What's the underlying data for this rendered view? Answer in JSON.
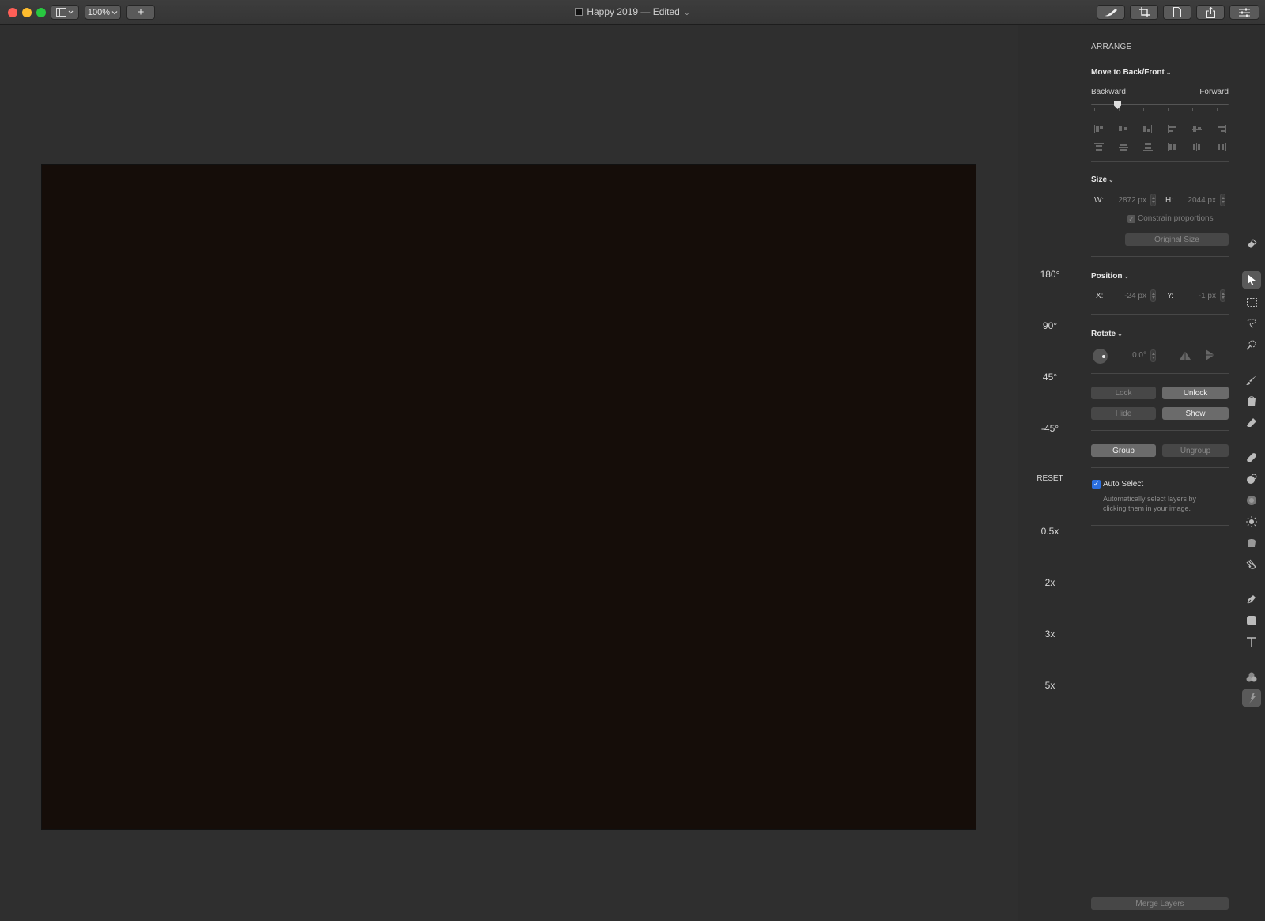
{
  "window": {
    "title": "Happy 2019 — Edited",
    "title_chevron": "⌄",
    "zoom_value": "100%",
    "add_label": "+"
  },
  "quick_actions": [
    "180°",
    "90°",
    "45°",
    "-45°",
    "RESET",
    "0.5x",
    "2x",
    "3x",
    "5x"
  ],
  "inspector": {
    "section_title": "ARRANGE",
    "move_label": "Move to Back/Front",
    "backward_label": "Backward",
    "forward_label": "Forward",
    "size_label": "Size",
    "w_label": "W:",
    "w_value": "2872 px",
    "h_label": "H:",
    "h_value": "2044 px",
    "constrain_label": "Constrain proportions",
    "original_size_label": "Original Size",
    "position_label": "Position",
    "x_label": "X:",
    "x_value": "-24 px",
    "y_label": "Y:",
    "y_value": "-1 px",
    "rotate_label": "Rotate",
    "rotate_value": "0.0°",
    "lock_label": "Lock",
    "unlock_label": "Unlock",
    "hide_label": "Hide",
    "show_label": "Show",
    "group_label": "Group",
    "ungroup_label": "Ungroup",
    "auto_select_label": "Auto Select",
    "auto_select_checked": true,
    "auto_select_desc": "Automatically select layers by clicking them in your image.",
    "merge_layers_label": "Merge Layers"
  },
  "tools": [
    "paint-bucket-icon",
    "arrow-select-icon",
    "rect-select-icon",
    "lasso-icon",
    "magic-icon",
    "brush-icon",
    "bucket-icon",
    "eraser-icon",
    "bandage-icon",
    "clone-icon",
    "blur-icon",
    "sun-icon",
    "sponge-icon",
    "smudge-icon",
    "pen-icon",
    "shape-icon",
    "text-icon",
    "color-adjust-icon",
    "effects-icon"
  ],
  "colors": {
    "canvas_image": "#150d09",
    "accent": "#2b6fe0"
  }
}
